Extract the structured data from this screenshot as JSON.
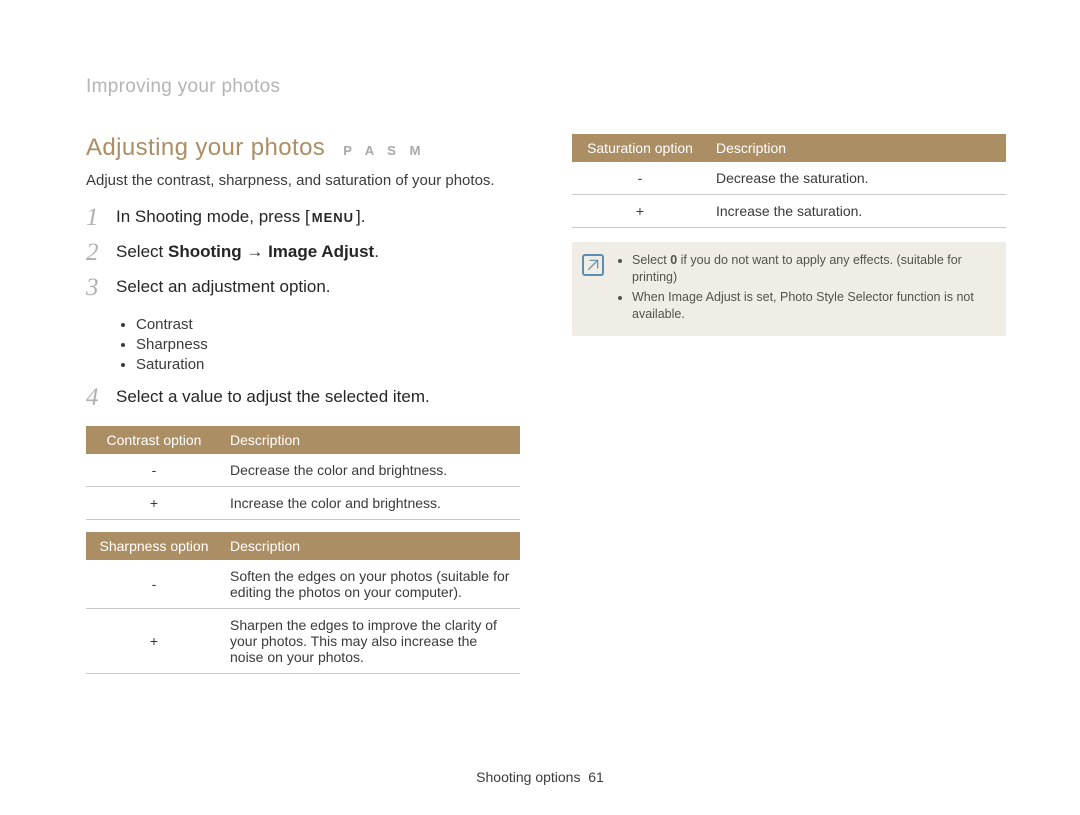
{
  "breadcrumb": "Improving your photos",
  "title": "Adjusting your photos",
  "modes": "P A S M",
  "intro": "Adjust the contrast, sharpness, and saturation of your photos.",
  "steps": [
    {
      "num": "1",
      "pre": "In Shooting mode, press [",
      "badge": "MENU",
      "post": "]."
    },
    {
      "num": "2",
      "pre": "Select ",
      "strong": "Shooting → Image Adjust",
      "post": "."
    },
    {
      "num": "3",
      "pre": "Select an adjustment option."
    },
    {
      "num": "4",
      "pre": "Select a value to adjust the selected item."
    }
  ],
  "step3_bullets": [
    "Contrast",
    "Sharpness",
    "Saturation"
  ],
  "tables": {
    "contrast": {
      "head": [
        "Contrast option",
        "Description"
      ],
      "rows": [
        {
          "opt": "-",
          "desc": "Decrease the color and brightness."
        },
        {
          "opt": "+",
          "desc": "Increase the color and brightness."
        }
      ]
    },
    "sharpness": {
      "head": [
        "Sharpness option",
        "Description"
      ],
      "rows": [
        {
          "opt": "-",
          "desc": "Soften the edges on your photos (suitable for editing the photos on your computer)."
        },
        {
          "opt": "+",
          "desc": "Sharpen the edges to improve the clarity of your photos. This may also increase the noise on your photos."
        }
      ]
    },
    "saturation": {
      "head": [
        "Saturation option",
        "Description"
      ],
      "rows": [
        {
          "opt": "-",
          "desc": "Decrease the saturation."
        },
        {
          "opt": "+",
          "desc": "Increase the saturation."
        }
      ]
    }
  },
  "note": {
    "items": [
      {
        "pre": "Select ",
        "strong": "0",
        "post": " if you do not want to apply any effects. (suitable for printing)"
      },
      {
        "pre": "When Image Adjust is set, Photo Style Selector function is not available."
      }
    ]
  },
  "footer": {
    "section": "Shooting options",
    "page": "61"
  },
  "colors": {
    "accent": "#ab8e64",
    "muted": "#b4b4b4",
    "noteIcon": "#5d8db1",
    "noteBg": "#efede6"
  }
}
